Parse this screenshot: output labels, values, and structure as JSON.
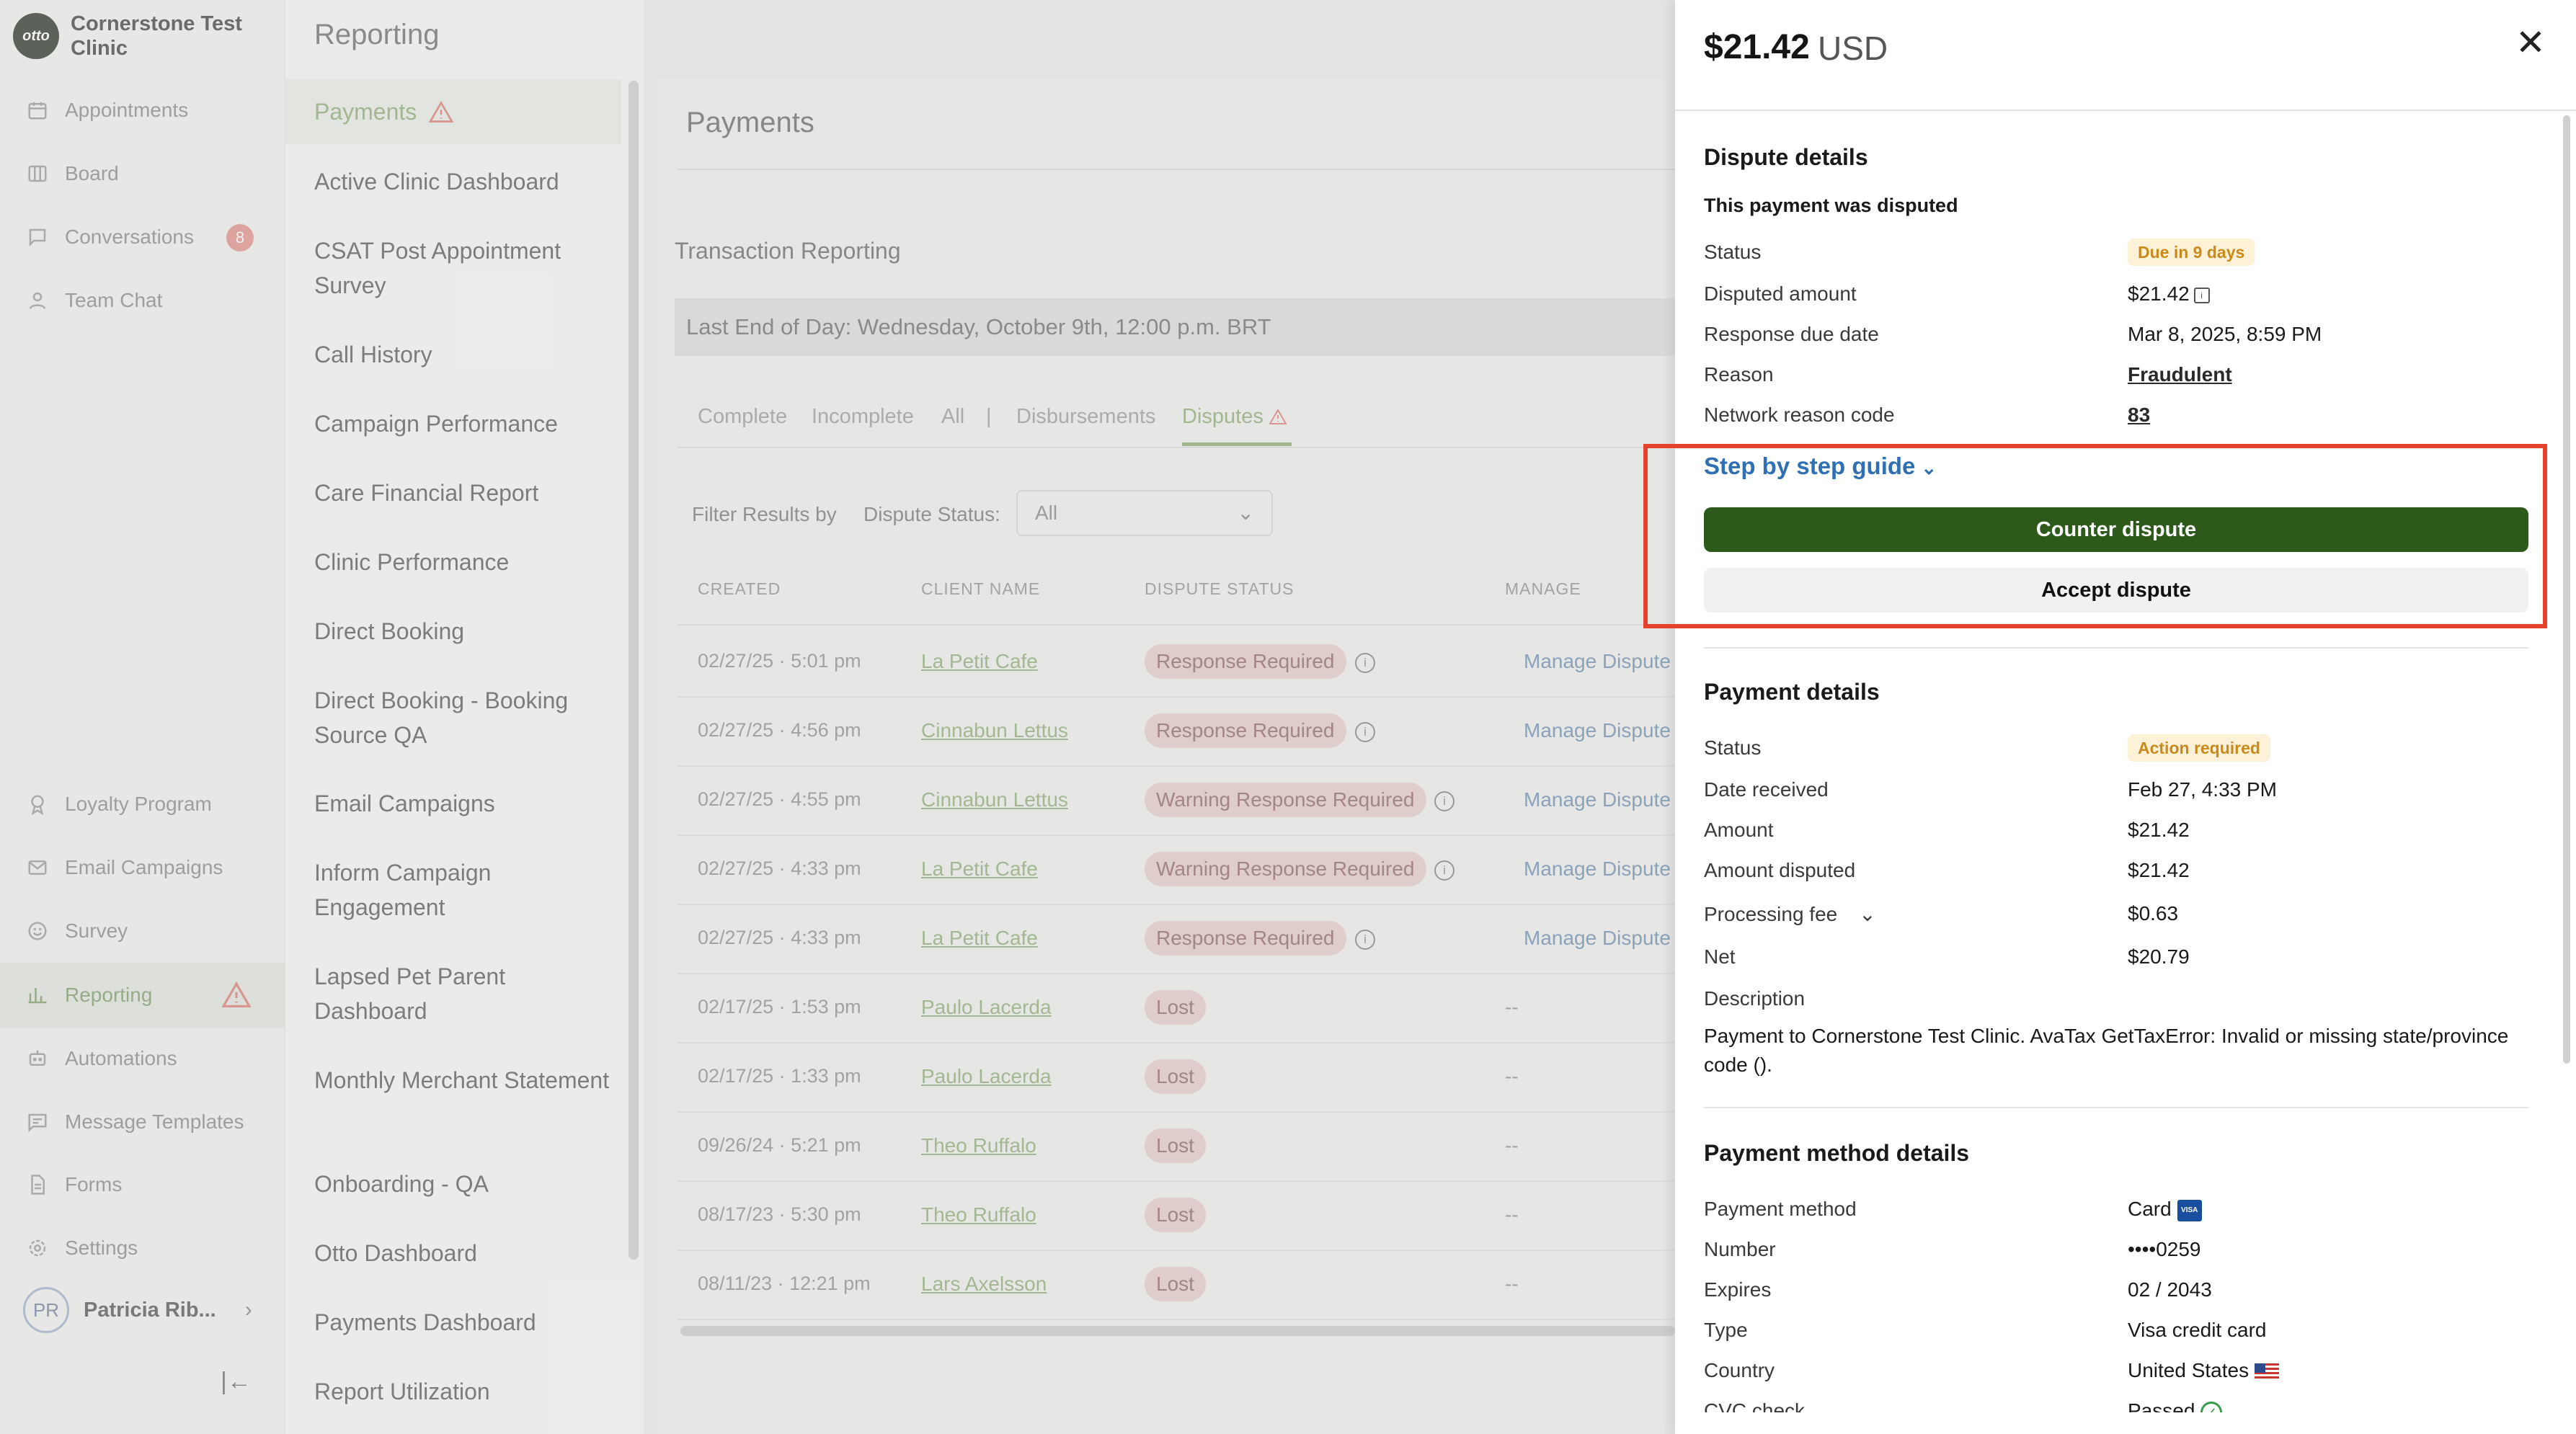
{
  "clinic": {
    "logo_text": "otto",
    "name": "Cornerstone Test Clinic"
  },
  "nav": {
    "items": [
      {
        "label": "Appointments",
        "icon": "calendar-icon"
      },
      {
        "label": "Board",
        "icon": "board-icon"
      },
      {
        "label": "Conversations",
        "icon": "chat-icon",
        "badge": "8"
      },
      {
        "label": "Team Chat",
        "icon": "team-icon"
      },
      {
        "label": "Loyalty Program",
        "icon": "ribbon-icon"
      },
      {
        "label": "Email Campaigns",
        "icon": "mail-icon"
      },
      {
        "label": "Survey",
        "icon": "smile-icon"
      },
      {
        "label": "Reporting",
        "icon": "chart-icon"
      },
      {
        "label": "Automations",
        "icon": "robot-icon"
      },
      {
        "label": "Message Templates",
        "icon": "message-icon"
      },
      {
        "label": "Forms",
        "icon": "document-icon"
      },
      {
        "label": "Settings",
        "icon": "gear-icon"
      }
    ],
    "user_initials": "PR",
    "user_name": "Patricia Rib..."
  },
  "reports": {
    "title": "Reporting",
    "items": [
      "Payments",
      "Active Clinic Dashboard",
      "CSAT Post Appointment Survey",
      "Call History",
      "Campaign Performance",
      "Care Financial Report",
      "Clinic Performance",
      "Direct Booking",
      "Direct Booking - Booking Source QA",
      "Email Campaigns",
      "Inform Campaign Engagement",
      "Lapsed Pet Parent Dashboard",
      "Monthly Merchant Statement",
      "Onboarding - QA",
      "Otto Dashboard",
      "Payments Dashboard",
      "Report Utilization"
    ]
  },
  "main": {
    "title": "Payments",
    "section": "Transaction Reporting",
    "eod": "Last End of Day: Wednesday, October 9th, 12:00 p.m. BRT",
    "tabs": [
      "Complete",
      "Incomplete",
      "All",
      "|",
      "Disbursements",
      "Disputes"
    ],
    "filter_label": "Filter Results by",
    "filter_sub": "Dispute Status:",
    "filter_value": "All",
    "columns": [
      "CREATED",
      "CLIENT NAME",
      "DISPUTE STATUS",
      "MANAGE"
    ],
    "manage_label": "Manage Dispute",
    "rows": [
      {
        "created": "02/27/25 · 5:01 pm",
        "client": "La Petit Cafe",
        "status": "Response Required",
        "manage": "Manage Dispute"
      },
      {
        "created": "02/27/25 · 4:56 pm",
        "client": "Cinnabun Lettus",
        "status": "Response Required",
        "manage": "Manage Dispute"
      },
      {
        "created": "02/27/25 · 4:55 pm",
        "client": "Cinnabun Lettus",
        "status": "Warning Response Required",
        "manage": "Manage Dispute"
      },
      {
        "created": "02/27/25 · 4:33 pm",
        "client": "La Petit Cafe",
        "status": "Warning Response Required",
        "manage": "Manage Dispute"
      },
      {
        "created": "02/27/25 · 4:33 pm",
        "client": "La Petit Cafe",
        "status": "Response Required",
        "manage": "Manage Dispute"
      },
      {
        "created": "02/17/25 · 1:53 pm",
        "client": "Paulo Lacerda",
        "status": "Lost",
        "manage": "--"
      },
      {
        "created": "02/17/25 · 1:33 pm",
        "client": "Paulo Lacerda",
        "status": "Lost",
        "manage": "--"
      },
      {
        "created": "09/26/24 · 5:21 pm",
        "client": "Theo Ruffalo",
        "status": "Lost",
        "manage": "--"
      },
      {
        "created": "08/17/23 · 5:30 pm",
        "client": "Theo Ruffalo",
        "status": "Lost",
        "manage": "--"
      },
      {
        "created": "08/11/23 · 12:21 pm",
        "client": "Lars Axelsson",
        "status": "Lost",
        "manage": "--"
      }
    ]
  },
  "drawer": {
    "amount": "$21.42",
    "currency": "USD",
    "close_icon": "close-icon",
    "dispute": {
      "title": "Dispute details",
      "subtitle": "This payment was disputed",
      "status_label": "Status",
      "status_value": "Due in 9 days",
      "disputed_amount_label": "Disputed amount",
      "disputed_amount_value": "$21.42",
      "due_label": "Response due date",
      "due_value": "Mar 8, 2025, 8:59 PM",
      "reason_label": "Reason",
      "reason_value": "Fraudulent",
      "code_label": "Network reason code",
      "code_value": "83",
      "guide_label": "Step by step guide",
      "counter_label": "Counter dispute",
      "accept_label": "Accept dispute"
    },
    "payment": {
      "title": "Payment details",
      "status_label": "Status",
      "status_value": "Action required",
      "received_label": "Date received",
      "received_value": "Feb 27, 4:33 PM",
      "amount_label": "Amount",
      "amount_value": "$21.42",
      "disputed_label": "Amount disputed",
      "disputed_value": "$21.42",
      "fee_label": "Processing fee",
      "fee_value": "$0.63",
      "net_label": "Net",
      "net_value": "$20.79",
      "desc_label": "Description",
      "desc_value": "Payment to Cornerstone Test Clinic. AvaTax GetTaxError: Invalid or missing state/province code ()."
    },
    "method": {
      "title": "Payment method details",
      "method_label": "Payment method",
      "method_value": "Card",
      "card_brand": "VISA",
      "number_label": "Number",
      "number_value": "••••0259",
      "expires_label": "Expires",
      "expires_value": "02 / 2043",
      "type_label": "Type",
      "type_value": "Visa credit card",
      "country_label": "Country",
      "country_value": "United States",
      "cvc_label": "CVC check",
      "cvc_value": "Passed"
    }
  },
  "colors": {
    "accent_green": "#2d5a1b",
    "link_blue": "#2f6fb4",
    "highlight_red": "#e5412d",
    "warning_amber": "#c98a1b"
  }
}
